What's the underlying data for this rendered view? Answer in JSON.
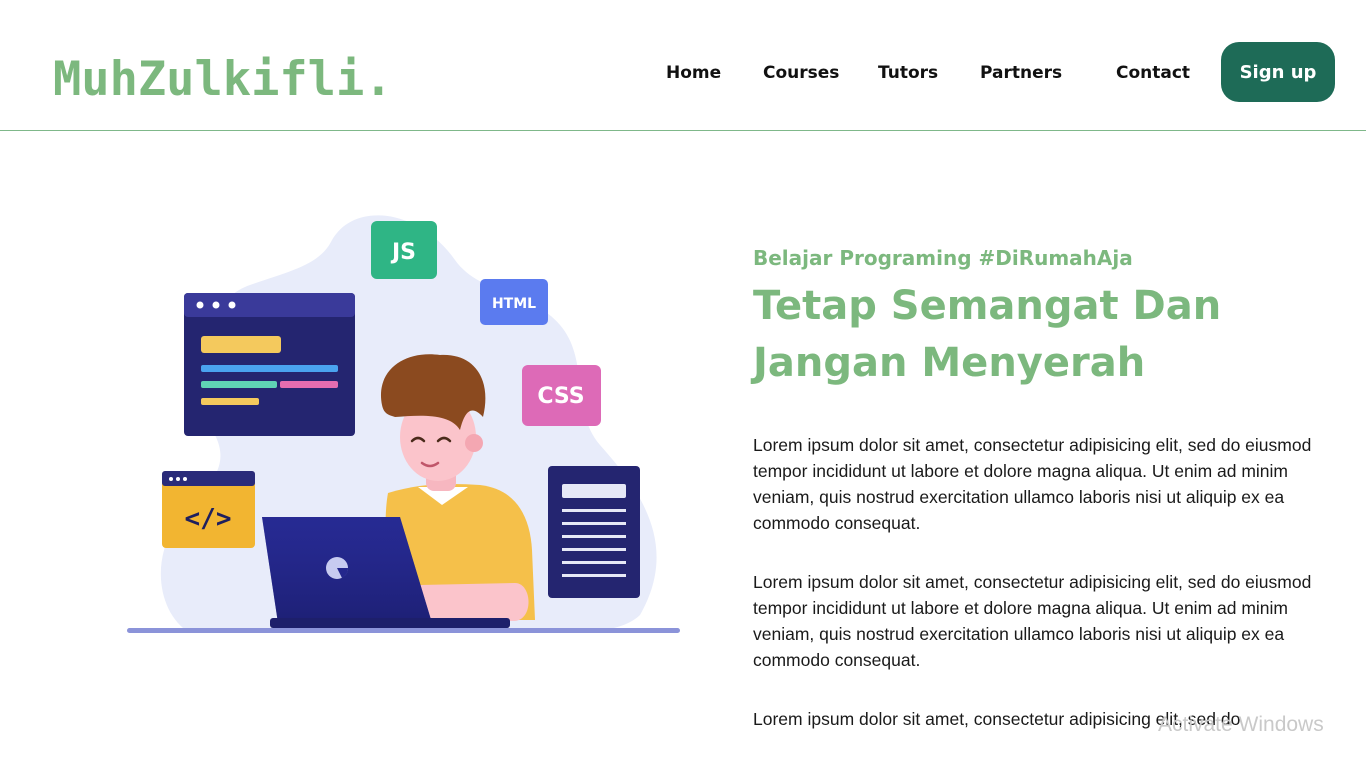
{
  "brand": {
    "logo": "MuhZulkifli."
  },
  "nav": {
    "items": [
      "Home",
      "Courses",
      "Tutors",
      "Partners",
      "Contact"
    ],
    "signup": "Sign up"
  },
  "hero": {
    "illustration": {
      "badges": [
        "JS",
        "HTML",
        "CSS"
      ],
      "code_tag": "</>"
    },
    "eyebrow": "Belajar Programing #DiRumahAja",
    "headline": "Tetap Semangat Dan Jangan Menyerah",
    "paragraphs": [
      "Lorem ipsum dolor sit amet, consectetur adipisicing elit, sed do eiusmod tempor incididunt ut labore et dolore magna aliqua. Ut enim ad minim veniam, quis nostrud exercitation ullamco laboris nisi ut aliquip ex ea commodo consequat.",
      "Lorem ipsum dolor sit amet, consectetur adipisicing elit, sed do eiusmod tempor incididunt ut labore et dolore magna aliqua. Ut enim ad minim veniam, quis nostrud exercitation ullamco laboris nisi ut aliquip ex ea commodo consequat.",
      "Lorem ipsum dolor sit amet, consectetur adipisicing elit, sed do"
    ]
  },
  "overlay": {
    "watermark": "Activate Windows"
  },
  "colors": {
    "brand_green": "#7cb87e",
    "button_green": "#1e6b57",
    "divider": "#7fb88a"
  }
}
